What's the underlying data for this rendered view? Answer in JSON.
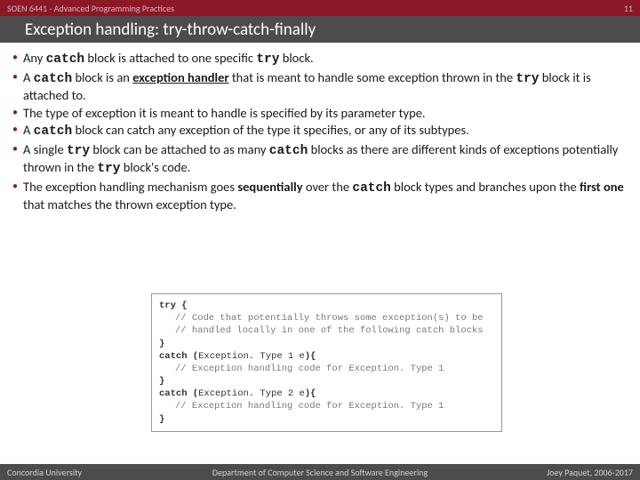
{
  "header": {
    "course": "SOEN 6441 - Advanced Programming Practices",
    "page_number": "11"
  },
  "title": "Exception handling: try-throw-catch-finally",
  "bullets": [
    {
      "pre": "Any ",
      "mono1": "catch",
      "mid1": " block is attached to one specific ",
      "mono2": "try",
      "post": " block."
    },
    {
      "pre": "A ",
      "mono1": "catch",
      "mid1": " block is an ",
      "bold1": "exception handler",
      "mid2": " that is meant to handle some exception thrown in the ",
      "mono2": "try",
      "post": " block it is attached to."
    },
    {
      "pre": "The type of exception it is meant to handle is specified by its parameter type.",
      "mono1": "",
      "mid1": "",
      "mono2": "",
      "post": ""
    },
    {
      "pre": "A ",
      "mono1": "catch",
      "mid1": " block can catch any exception of the type it specifies, or any of its subtypes.",
      "mono2": "",
      "post": ""
    },
    {
      "pre": "A single ",
      "mono1": "try",
      "mid1": " block can be attached to as many ",
      "mono2": "catch",
      "mid2": " blocks as there are different kinds of exceptions potentially thrown in the ",
      "mono3": "try",
      "post": " block's code."
    },
    {
      "pre": "The exception handling mechanism goes ",
      "bold1": "sequentially",
      "mid1": " over the ",
      "mono1": "catch",
      "mid2": " block types and branches upon the ",
      "bold2": "first one",
      "post": " that matches the thrown exception type."
    }
  ],
  "code": {
    "l1": "try {",
    "l2": "// Code that potentially throws some exception(s) to be",
    "l3": "// handled locally in one of the following catch blocks",
    "l4": "}",
    "l5a": "catch (",
    "l5b": "Exception. Type 1 e",
    "l5c": "){",
    "l6": "// Exception handling code for Exception. Type 1",
    "l7": "}",
    "l8a": "catch (",
    "l8b": "Exception. Type 2 e",
    "l8c": "){",
    "l9": "// Exception handling code for Exception. Type 1",
    "l10": "}"
  },
  "footer": {
    "left": "Concordia University",
    "center": "Department of Computer Science and Software Engineering",
    "right": "Joey Paquet, 2006-2017"
  }
}
